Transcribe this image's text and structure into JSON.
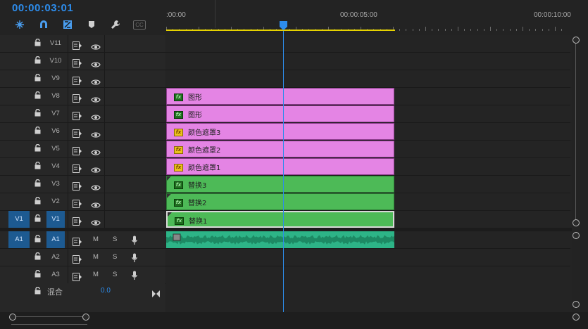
{
  "timecode": "00:00:03:01",
  "toolbar": {
    "tools": [
      {
        "name": "snap-icon"
      },
      {
        "name": "magnet-icon"
      },
      {
        "name": "linked-selection-icon"
      },
      {
        "name": "add-marker-icon"
      },
      {
        "name": "wrench-icon"
      },
      {
        "name": "captions-icon",
        "label": "CC"
      }
    ]
  },
  "ruler": {
    "labels": [
      ":00:00",
      "00:00:05:00",
      "00:00:10:00"
    ]
  },
  "video_tracks": [
    {
      "name": "V11"
    },
    {
      "name": "V10"
    },
    {
      "name": "V9"
    },
    {
      "name": "V8"
    },
    {
      "name": "V7"
    },
    {
      "name": "V6"
    },
    {
      "name": "V5"
    },
    {
      "name": "V4"
    },
    {
      "name": "V3"
    },
    {
      "name": "V2"
    },
    {
      "name": "V1",
      "source": "V1",
      "selected": true
    }
  ],
  "audio_tracks": [
    {
      "name": "A1",
      "source": "A1",
      "m": "M",
      "s": "S"
    },
    {
      "name": "A2",
      "m": "M",
      "s": "S"
    },
    {
      "name": "A3",
      "m": "M",
      "s": "S"
    }
  ],
  "mix": {
    "label": "混合",
    "value": "0.0"
  },
  "clips": [
    {
      "track": "V8",
      "label": "图形",
      "fx": "fx",
      "color": "#e484e4"
    },
    {
      "track": "V7",
      "label": "图形",
      "fx": "fx",
      "color": "#e484e4"
    },
    {
      "track": "V6",
      "label": "颜色遮罩3",
      "fx": "fx",
      "color": "#e484e4"
    },
    {
      "track": "V5",
      "label": "颜色遮罩2",
      "fx": "fx",
      "color": "#e484e4"
    },
    {
      "track": "V4",
      "label": "颜色遮罩1",
      "fx": "fx",
      "color": "#e484e4"
    },
    {
      "track": "V3",
      "label": "替换3",
      "fx": "fx",
      "color": "#4dba57"
    },
    {
      "track": "V2",
      "label": "替换2",
      "fx": "fx",
      "color": "#4dba57"
    },
    {
      "track": "V1",
      "label": "替换1",
      "fx": "fx",
      "color": "#4dba57"
    }
  ],
  "colors": {
    "accent": "#2d8ceb",
    "track_select": "#1d5a91",
    "pink_clip": "#e484e4",
    "green_clip": "#4dba57",
    "audio_wave": "#2db487",
    "work_area": "#e6d200"
  }
}
